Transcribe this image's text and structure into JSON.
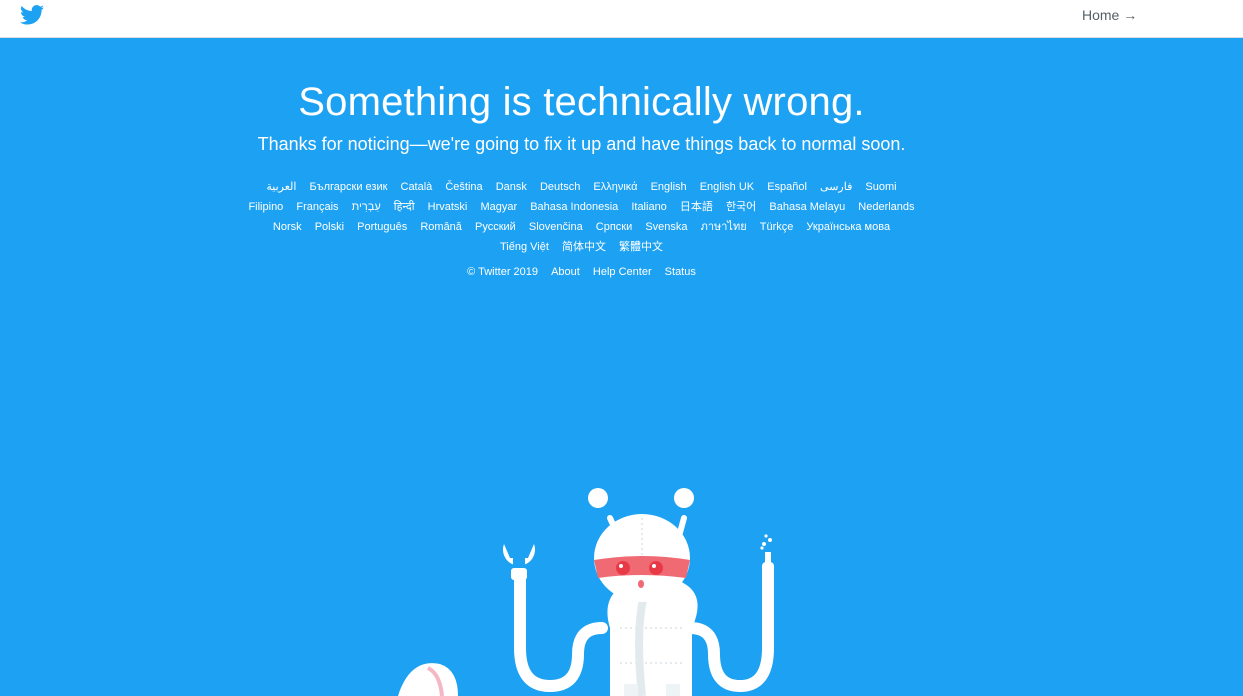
{
  "header": {
    "logo_icon": "twitter-bird-icon",
    "brand_color": "#1da1f2",
    "home_link": "Home →"
  },
  "error": {
    "title": "Something is technically wrong.",
    "message": "Thanks for noticing—we're going to fix it up and have things back to normal soon."
  },
  "languages": [
    "العربية",
    "Български език",
    "Català",
    "Čeština",
    "Dansk",
    "Deutsch",
    "Ελληνικά",
    "English",
    "English UK",
    "Español",
    "فارسی",
    "Suomi",
    "Filipino",
    "Français",
    "עִבְרִית",
    "हिन्दी",
    "Hrvatski",
    "Magyar",
    "Bahasa Indonesia",
    "Italiano",
    "日本語",
    "한국어",
    "Bahasa Melayu",
    "Nederlands",
    "Norsk",
    "Polski",
    "Português",
    "Română",
    "Русский",
    "Slovenčina",
    "Српски",
    "Svenska",
    "ภาษาไทย",
    "Türkçe",
    "Українська мова",
    "Tiếng Việt",
    "简体中文",
    "繁體中文"
  ],
  "footer": {
    "copyright": "© Twitter 2019",
    "about": "About",
    "help_center": "Help Center",
    "status": "Status"
  },
  "illustration": "robot-repair-illustration"
}
